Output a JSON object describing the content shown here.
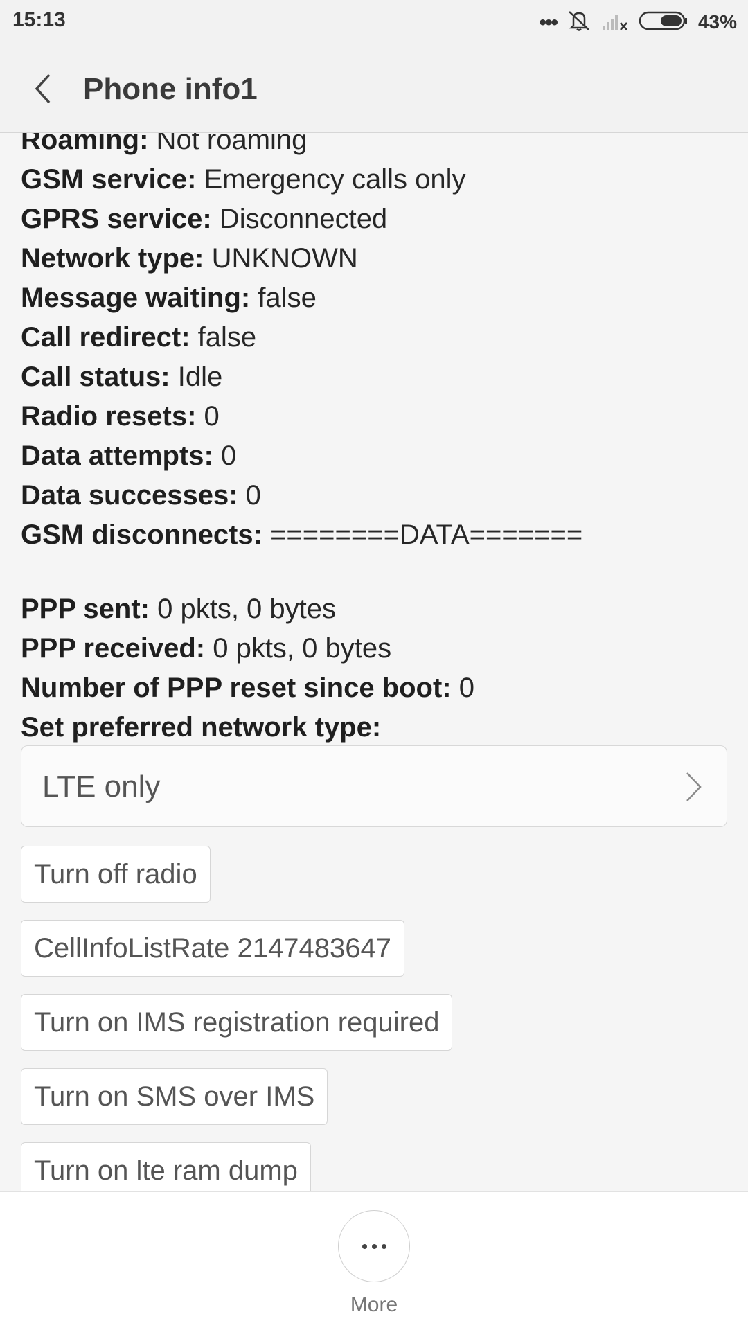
{
  "status_bar": {
    "time": "15:13",
    "battery": "43%",
    "icons": [
      "more-dots-icon",
      "vibrate-mute-icon",
      "no-signal-icon",
      "battery-icon"
    ]
  },
  "header": {
    "title": "Phone info1",
    "back_icon": "chevron-left-icon"
  },
  "info": {
    "items": [
      {
        "label": "Roaming:",
        "value": " Not roaming"
      },
      {
        "label": "GSM service:",
        "value": " Emergency calls only"
      },
      {
        "label": "GPRS service:",
        "value": " Disconnected"
      },
      {
        "label": "Network type:",
        "value": " UNKNOWN"
      },
      {
        "label": "Message waiting:",
        "value": " false"
      },
      {
        "label": "Call redirect:",
        "value": " false"
      },
      {
        "label": "Call status:",
        "value": " Idle"
      },
      {
        "label": "Radio resets:",
        "value": " 0"
      },
      {
        "label": "Data attempts:",
        "value": " 0"
      },
      {
        "label": "Data successes:",
        "value": " 0"
      },
      {
        "label": "GSM disconnects:",
        "value": " ========DATA======="
      }
    ],
    "ppp": [
      {
        "label": "PPP sent:",
        "value": " 0 pkts, 0 bytes"
      },
      {
        "label": "PPP received:",
        "value": " 0 pkts, 0 bytes"
      },
      {
        "label": "Number of PPP reset since boot:",
        "value": " 0"
      },
      {
        "label": "Set preferred network type:",
        "value": ""
      }
    ]
  },
  "preferred_network": {
    "value": "LTE only"
  },
  "buttons": {
    "turn_off_radio": "Turn off radio",
    "cell_info_rate": "CellInfoListRate 2147483647",
    "ims_registration": "Turn on IMS registration required",
    "sms_over_ims": "Turn on SMS over IMS",
    "lte_ram_dump": "Turn on lte ram dump"
  },
  "bottom": {
    "more_label": "More"
  }
}
